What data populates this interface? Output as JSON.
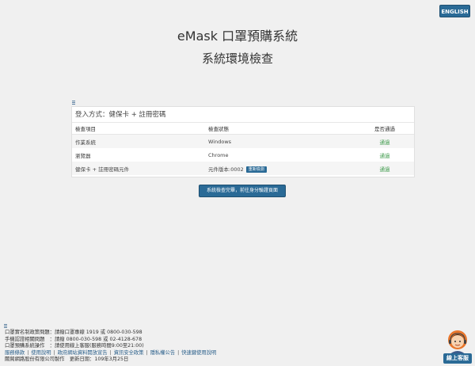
{
  "header": {
    "language_button": "ENGLISH",
    "title": "eMask 口罩預購系統",
    "subtitle": "系統環境檢查"
  },
  "panel": {
    "title": "登入方式：健保卡 + 註冊密碼",
    "columns": {
      "item": "檢查項目",
      "status": "檢查狀態",
      "pass": "是否通過"
    },
    "rows": [
      {
        "item": "作業系統",
        "status": "Windows",
        "pass": "通過"
      },
      {
        "item": "瀏覽器",
        "status": "Chrome",
        "pass": "通過"
      },
      {
        "item": "健保卡 + 註冊密碼元件",
        "status": "元件版本:0002",
        "action": "重新檢測",
        "pass": "通過"
      }
    ]
  },
  "proceed_button": "系統檢查完畢，前往身分驗證頁面",
  "footer": {
    "lines": [
      "口罩實名制政策問題：請撥口罩專線 1919 或 0800-030-598",
      "手機認證相關問題　：請撥 0800-030-598 或 02-4128-678",
      "口罩預購系統操作　：請使用線上客服(服務時間9:00至21:00)"
    ],
    "links": [
      "服務條款",
      "使用說明",
      "政府網站資料開放宣告",
      "資訊安全政策",
      "隱私權公告",
      "快速鍵使用說明"
    ],
    "copyright": "關貿網路股份有限公司製作　更新日期：109年3月25日"
  },
  "helper": {
    "label": "線上客服"
  },
  "colors": {
    "primary": "#2a6a96",
    "pass": "#3c9a4a",
    "background": "#f0f0f0"
  }
}
